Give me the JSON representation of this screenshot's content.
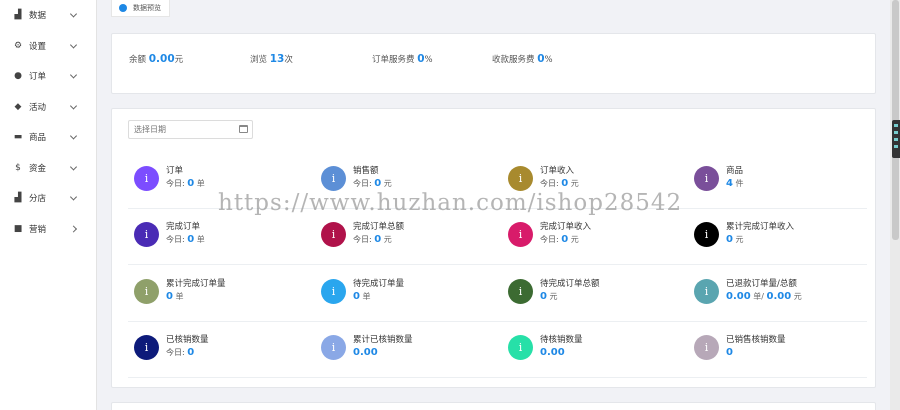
{
  "sidebar": {
    "items": [
      {
        "label": "数据",
        "icon": "bar-chart-icon",
        "glyph": "▟",
        "arrow": "down"
      },
      {
        "label": "设置",
        "icon": "gear-icon",
        "glyph": "⚙",
        "arrow": "down"
      },
      {
        "label": "订单",
        "icon": "info-circle-icon",
        "glyph": "●",
        "arrow": "down"
      },
      {
        "label": "活动",
        "icon": "tag-icon",
        "glyph": "◆",
        "arrow": "down"
      },
      {
        "label": "商品",
        "icon": "printer-icon",
        "glyph": "▬",
        "arrow": "down"
      },
      {
        "label": "资金",
        "icon": "dollar-icon",
        "glyph": "$",
        "arrow": "down"
      },
      {
        "label": "分店",
        "icon": "bar-chart-icon",
        "glyph": "▟",
        "arrow": "down"
      },
      {
        "label": "营销",
        "icon": "book-icon",
        "glyph": "■",
        "arrow": "right"
      }
    ]
  },
  "tab": {
    "label": "数据预览",
    "dot_color": "#1e88e5"
  },
  "stats": [
    {
      "label": "余额",
      "value": "0.00",
      "unit": "元"
    },
    {
      "label": "浏览",
      "value": "13",
      "unit": "次"
    },
    {
      "label": "订单服务费",
      "value": "0",
      "unit": "%"
    },
    {
      "label": "收款服务费",
      "value": "0",
      "unit": "%"
    }
  ],
  "date_filter": {
    "placeholder": "选择日期"
  },
  "metrics": [
    {
      "title": "订单",
      "prefix": "今日:",
      "value": "0",
      "unit": "单",
      "color": "#7c4dff"
    },
    {
      "title": "销售额",
      "prefix": "今日:",
      "value": "0",
      "unit": "元",
      "color": "#5c8fd6"
    },
    {
      "title": "订单收入",
      "prefix": "今日:",
      "value": "0",
      "unit": "元",
      "color": "#a88a2e"
    },
    {
      "title": "商品",
      "prefix": "",
      "value": "4",
      "unit": "件",
      "color": "#7a4f9a"
    },
    {
      "title": "完成订单",
      "prefix": "今日:",
      "value": "0",
      "unit": "单",
      "color": "#4a2bb5"
    },
    {
      "title": "完成订单总额",
      "prefix": "今日:",
      "value": "0",
      "unit": "元",
      "color": "#b0124a"
    },
    {
      "title": "完成订单收入",
      "prefix": "今日:",
      "value": "0",
      "unit": "元",
      "color": "#d81b6a"
    },
    {
      "title": "累计完成订单收入",
      "prefix": "",
      "value": "0",
      "unit": "元",
      "color": "#000000"
    },
    {
      "title": "累计完成订单量",
      "prefix": "",
      "value": "0",
      "unit": "单",
      "color": "#8fa06a"
    },
    {
      "title": "待完成订单量",
      "prefix": "",
      "value": "0",
      "unit": "单",
      "color": "#2aa6ee"
    },
    {
      "title": "待完成订单总额",
      "prefix": "",
      "value": "0",
      "unit": "元",
      "color": "#3c6b32"
    },
    {
      "title": "已退款订单量/总额",
      "prefix": "",
      "value": "0.00",
      "unit": "单/",
      "value2": "0.00",
      "unit2": "元",
      "color": "#5aa5b0"
    },
    {
      "title": "已核销数量",
      "prefix": "今日:",
      "value": "0",
      "unit": "",
      "color": "#0d1a7a"
    },
    {
      "title": "累计已核销数量",
      "prefix": "",
      "value": "0.00",
      "unit": "",
      "color": "#8aa8e6"
    },
    {
      "title": "待核销数量",
      "prefix": "",
      "value": "0.00",
      "unit": "",
      "color": "#27e0a8"
    },
    {
      "title": "已销售核销数量",
      "prefix": "",
      "value": "0",
      "unit": "",
      "color": "#b7a8b8"
    }
  ],
  "watermark": "https://www.huzhan.com/ishop28542"
}
